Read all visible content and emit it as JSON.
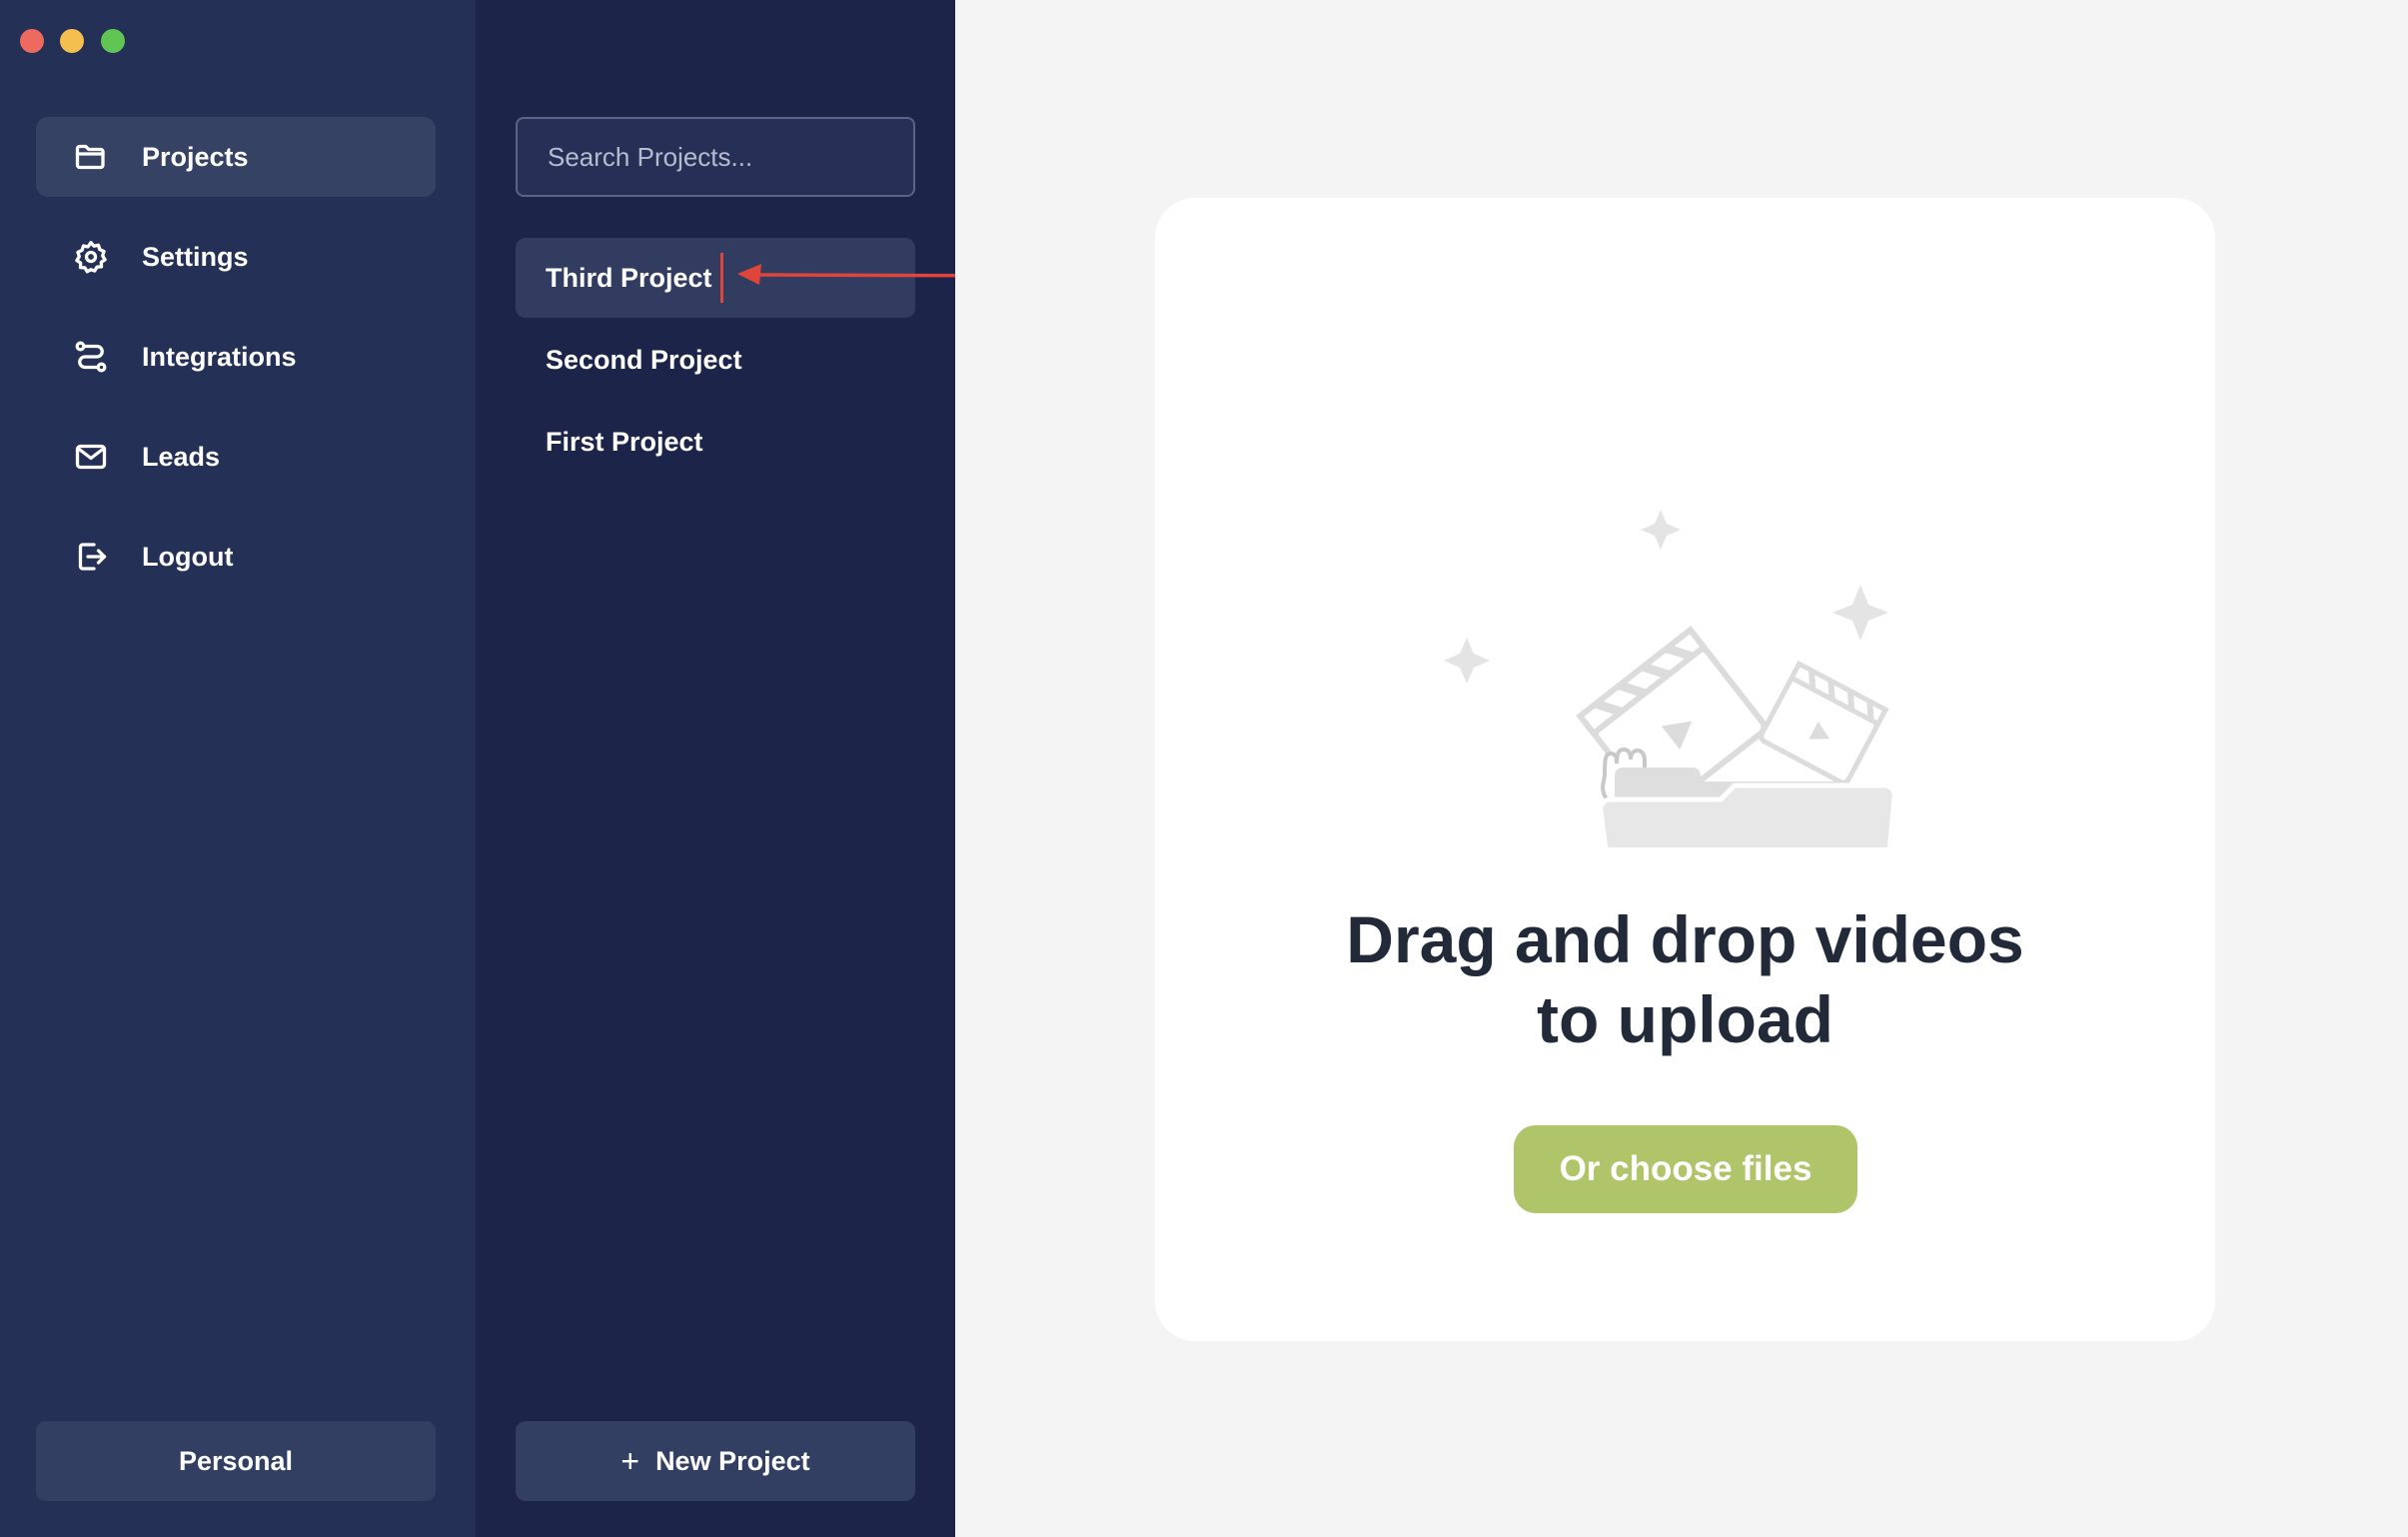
{
  "window": {
    "traffic_lights": [
      "close",
      "minimize",
      "maximize"
    ]
  },
  "sidebar": {
    "items": [
      {
        "label": "Projects",
        "icon": "folder-icon"
      },
      {
        "label": "Settings",
        "icon": "gear-icon"
      },
      {
        "label": "Integrations",
        "icon": "route-icon"
      },
      {
        "label": "Leads",
        "icon": "mail-icon"
      },
      {
        "label": "Logout",
        "icon": "logout-icon"
      }
    ],
    "active_item": "Projects",
    "workspace_label": "Personal"
  },
  "projects_panel": {
    "search_placeholder": "Search Projects...",
    "projects": [
      {
        "label": "Third Project"
      },
      {
        "label": "Second Project"
      },
      {
        "label": "First Project"
      }
    ],
    "active_project": "Third Project",
    "new_project_label": "New Project",
    "new_project_icon": "plus-icon"
  },
  "upload": {
    "headline_line1": "Drag and drop videos",
    "headline_line2": "to upload",
    "choose_button_label": "Or choose files"
  },
  "colors": {
    "sidebar_bg": "#253056",
    "projects_bg": "#1c2449",
    "accent_green": "#b0c56a",
    "annotation_red": "#e0453a"
  }
}
